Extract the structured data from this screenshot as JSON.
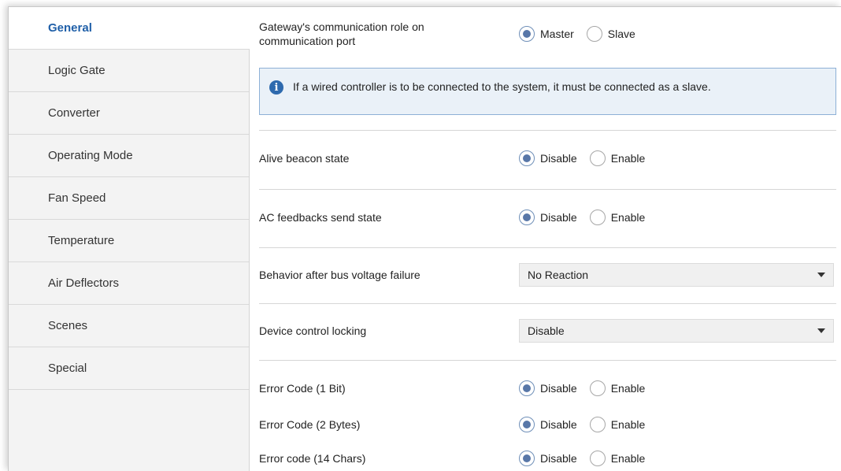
{
  "sidebar": {
    "items": [
      {
        "label": "General"
      },
      {
        "label": "Logic Gate"
      },
      {
        "label": "Converter"
      },
      {
        "label": "Operating Mode"
      },
      {
        "label": "Fan Speed"
      },
      {
        "label": "Temperature"
      },
      {
        "label": "Air Deflectors"
      },
      {
        "label": "Scenes"
      },
      {
        "label": "Special"
      }
    ],
    "active_index": 0
  },
  "params": {
    "comm_role": {
      "label_line1": "Gateway's communication role on",
      "label_line2": "communication port",
      "options": [
        "Master",
        "Slave"
      ],
      "selected": "Master"
    },
    "info_text": "If a wired controller is to be connected to the system, it must be connected as a slave.",
    "alive_beacon": {
      "label": "Alive beacon state",
      "options": [
        "Disable",
        "Enable"
      ],
      "selected": "Disable"
    },
    "ac_feedbacks": {
      "label": "AC feedbacks send state",
      "options": [
        "Disable",
        "Enable"
      ],
      "selected": "Disable"
    },
    "bus_failure": {
      "label": "Behavior after bus voltage failure",
      "value": "No Reaction"
    },
    "control_locking": {
      "label": "Device control locking",
      "value": "Disable"
    },
    "error_1bit": {
      "label": "Error Code (1 Bit)",
      "options": [
        "Disable",
        "Enable"
      ],
      "selected": "Disable"
    },
    "error_2bytes": {
      "label": "Error Code (2 Bytes)",
      "options": [
        "Disable",
        "Enable"
      ],
      "selected": "Disable"
    },
    "error_14chars": {
      "label": "Error code (14 Chars)",
      "options": [
        "Disable",
        "Enable"
      ],
      "selected": "Disable"
    }
  },
  "colors": {
    "accent": "#1f5fa8",
    "radio_fill": "#5877a8",
    "info_bg": "#eaf1f8",
    "info_border": "#8db0d6"
  }
}
